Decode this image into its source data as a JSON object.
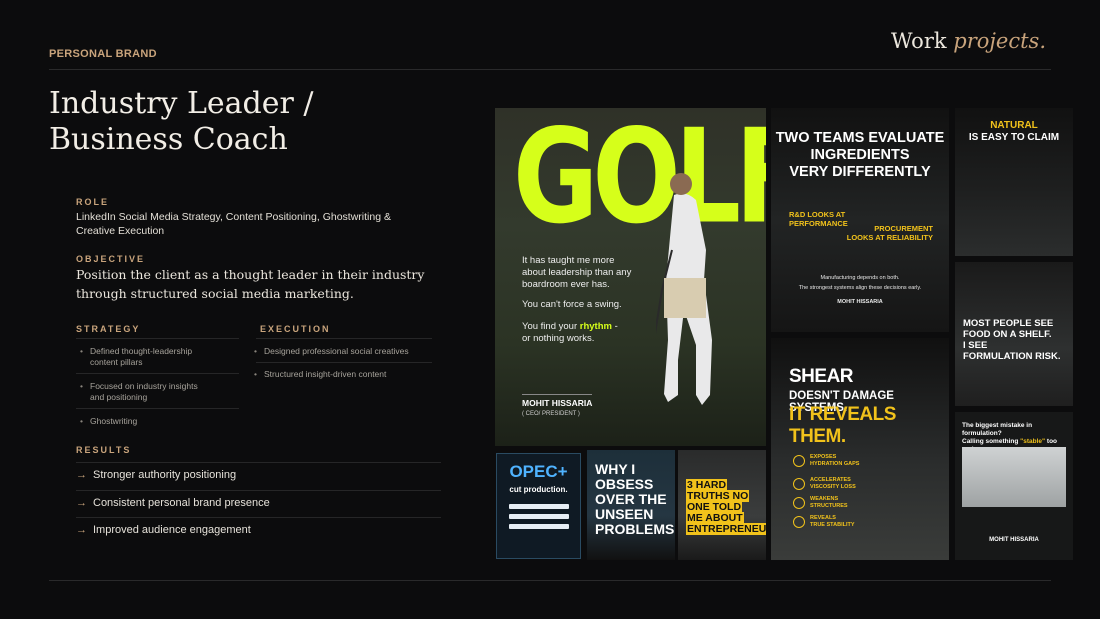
{
  "header": {
    "eyebrow": "PERSONAL BRAND",
    "brand_word": "Work",
    "brand_italic": "projects."
  },
  "title": {
    "line1": "Industry Leader /",
    "line2": "Business Coach"
  },
  "role": {
    "label": "ROLE",
    "text_line1": "LinkedIn Social Media Strategy, Content Positioning, Ghostwriting &",
    "text_line2": "Creative Execution"
  },
  "objective": {
    "label": "OBJECTIVE",
    "line1": "Position the client as a thought leader in their industry",
    "line2": "through structured social media marketing."
  },
  "strategy": {
    "label": "STRATEGY",
    "items": [
      {
        "line1": "Defined thought-leadership",
        "line2": "content pillars"
      },
      {
        "line1": "Focused on industry insights",
        "line2": "and positioning"
      },
      {
        "line1": "Ghostwriting",
        "line2": ""
      }
    ]
  },
  "execution": {
    "label": "EXECUTION",
    "items": [
      "Designed professional social creatives",
      "Structured insight-driven content"
    ]
  },
  "results": {
    "label": "RESULTS",
    "items": [
      "Stronger authority positioning",
      "Consistent personal brand presence",
      "Improved audience engagement"
    ]
  },
  "collage": {
    "golf": {
      "headline": "GOLF",
      "p1_l1": "It has taught me more",
      "p1_l2": "about leadership than any",
      "p1_l3": "boardroom ever has.",
      "p2": "You can't force a swing.",
      "p3_l1a": "You find your ",
      "p3_l1b": "rhythm",
      "p3_l1c": " -",
      "p3_l2": "or nothing works.",
      "name": "MOHIT HISSARIA",
      "name_sub": "( CEO/ PRESIDENT )"
    },
    "teams": {
      "l1": "TWO TEAMS EVALUATE",
      "l2": "INGREDIENTS",
      "l3": "VERY DIFFERENTLY",
      "rd1": "R&D LOOKS AT",
      "rd2": "PERFORMANCE",
      "pr1": "PROCUREMENT",
      "pr2": "LOOKS AT RELIABILITY",
      "f1": "Manufacturing depends on both.",
      "f2": "The strongest systems align these decisions early.",
      "name": "MOHIT HISSARIA"
    },
    "natural": {
      "l1": "NATURAL",
      "l2": "IS EASY TO CLAIM"
    },
    "shelf": {
      "l1": "MOST PEOPLE SEE",
      "l2": "FOOD ON A SHELF.",
      "l3": "I SEE",
      "l4": "FORMULATION RISK."
    },
    "shear": {
      "l1": "SHEAR",
      "l2": "DOESN'T DAMAGE SYSTEMS.",
      "l3": "IT REVEALS THEM.",
      "items": [
        {
          "a": "EXPOSES",
          "b": "HYDRATION GAPS"
        },
        {
          "a": "ACCELERATES",
          "b": "VISCOSITY LOSS"
        },
        {
          "a": "WEAKENS",
          "b": "STRUCTURES"
        },
        {
          "a": "REVEALS",
          "b": "TRUE STABILITY"
        }
      ]
    },
    "mistake": {
      "l1": "The biggest mistake in formulation?",
      "l2a": "Calling something ",
      "l2b": "\"stable\"",
      "l2c": " too early.",
      "name": "MOHIT HISSARIA"
    },
    "opec": {
      "l1": "OPEC+",
      "l2": "cut production."
    },
    "obsess": {
      "l1": "WHY I",
      "l2": "OBSESS",
      "l3": "OVER THE",
      "l4": "UNSEEN",
      "l5": "PROBLEMS..."
    },
    "truths": {
      "l1": "3 HARD",
      "l2": "TRUTHS NO",
      "l3": "ONE TOLD",
      "l4": "ME ABOUT",
      "l5": "ENTREPRENEURSHIP"
    }
  },
  "colors": {
    "accent_gold": "#c9a47c",
    "neon": "#d6ff1a",
    "yellow": "#f1c21b",
    "background": "#0c0c0d"
  }
}
